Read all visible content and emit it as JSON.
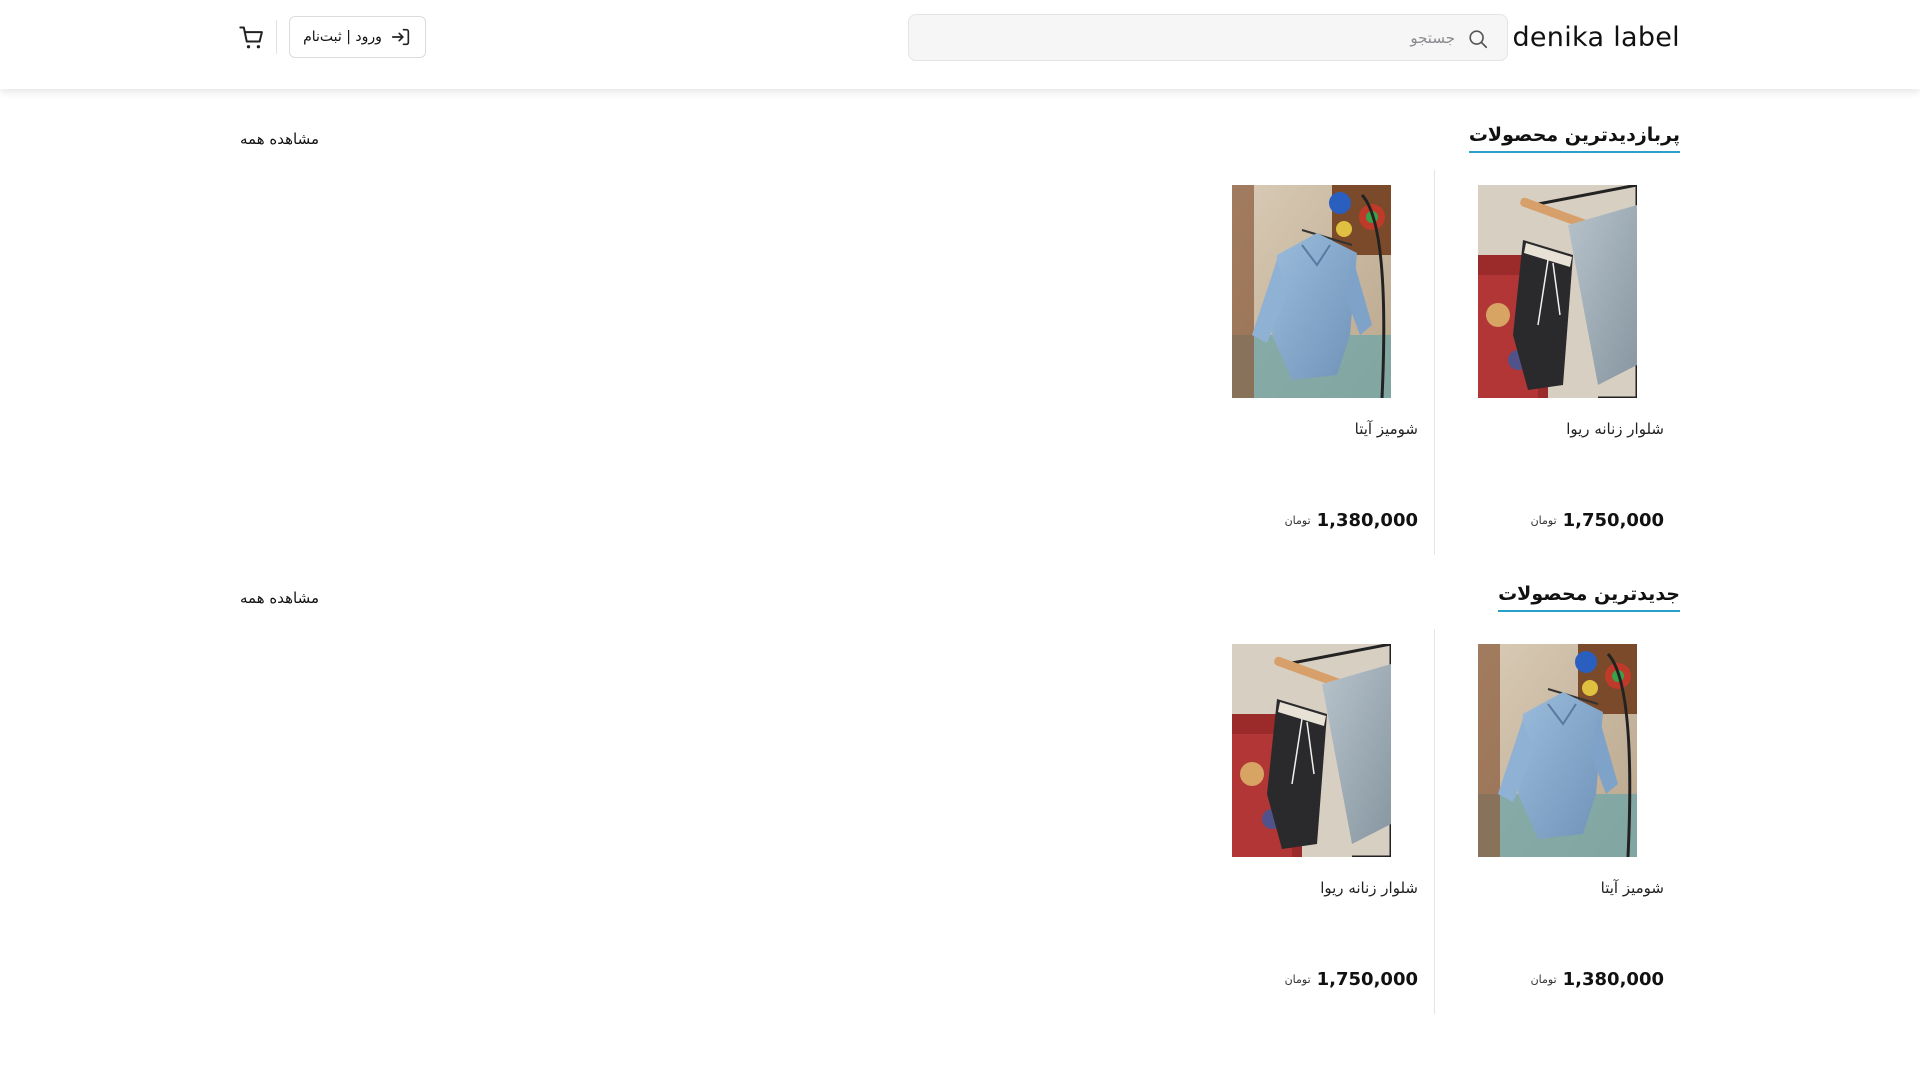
{
  "header": {
    "brand": "denika label",
    "search_placeholder": "جستجو",
    "login_label": "ورود | ثبت‌نام"
  },
  "sections": [
    {
      "title": "پربازدیدترین محصولات",
      "view_all": "مشاهده همه",
      "products": [
        {
          "name": "شلوار زنانه ریوا",
          "price": "1,750,000",
          "currency": "تومان",
          "image": "pants"
        },
        {
          "name": "شومیز آیتا",
          "price": "1,380,000",
          "currency": "تومان",
          "image": "shirt"
        }
      ]
    },
    {
      "title": "جدیدترین محصولات",
      "view_all": "مشاهده همه",
      "products": [
        {
          "name": "شومیز آیتا",
          "price": "1,380,000",
          "currency": "تومان",
          "image": "shirt"
        },
        {
          "name": "شلوار زنانه ریوا",
          "price": "1,750,000",
          "currency": "تومان",
          "image": "pants"
        }
      ]
    }
  ],
  "colors": {
    "accent_underline": "#29a0c9"
  }
}
